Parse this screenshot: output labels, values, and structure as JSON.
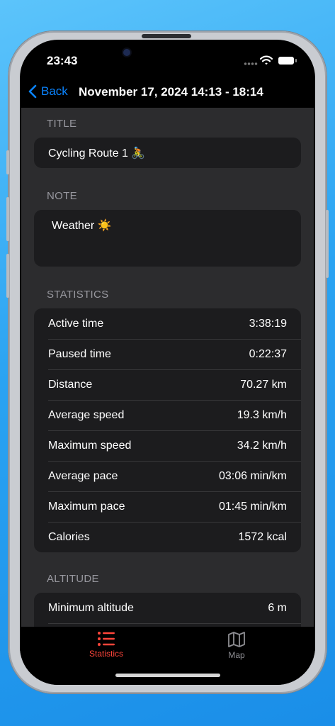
{
  "status_bar": {
    "time": "23:43"
  },
  "nav": {
    "back_label": "Back",
    "title": "November 17, 2024 14:13 - 18:14"
  },
  "sections": {
    "title": {
      "header": "TITLE",
      "value": "Cycling Route 1 🚴"
    },
    "note": {
      "header": "NOTE",
      "value": "Weather ☀️"
    },
    "statistics": {
      "header": "STATISTICS",
      "rows": [
        {
          "label": "Active time",
          "value": "3:38:19"
        },
        {
          "label": "Paused time",
          "value": "0:22:37"
        },
        {
          "label": "Distance",
          "value": "70.27 km"
        },
        {
          "label": "Average speed",
          "value": "19.3 km/h"
        },
        {
          "label": "Maximum speed",
          "value": "34.2 km/h"
        },
        {
          "label": "Average pace",
          "value": "03:06 min/km"
        },
        {
          "label": "Maximum pace",
          "value": "01:45 min/km"
        },
        {
          "label": "Calories",
          "value": "1572 kcal"
        }
      ]
    },
    "altitude": {
      "header": "ALTITUDE",
      "rows": [
        {
          "label": "Minimum altitude",
          "value": "6 m"
        }
      ]
    }
  },
  "tabs": [
    {
      "label": "Statistics",
      "icon": "list-icon",
      "active": true
    },
    {
      "label": "Map",
      "icon": "map-icon",
      "active": false
    }
  ],
  "colors": {
    "accent": "#0a84ff",
    "active_tab": "#ff453a",
    "inactive_tab": "#8e8e93",
    "card_bg": "#1c1c1e",
    "content_bg": "#2c2c2e"
  }
}
